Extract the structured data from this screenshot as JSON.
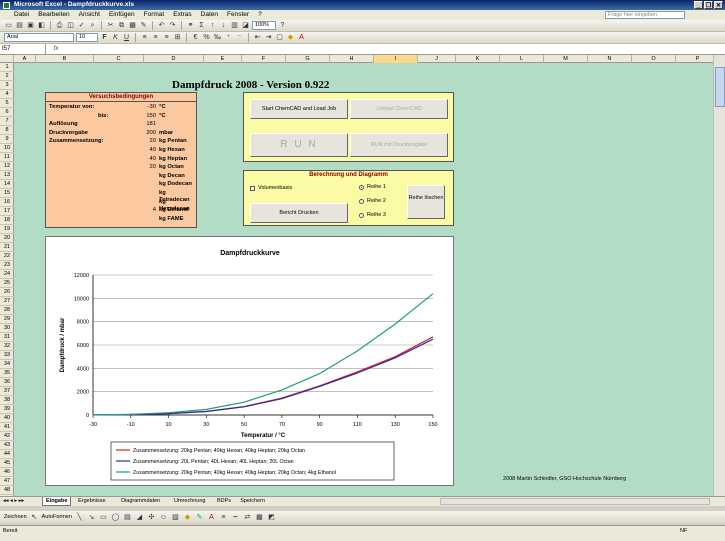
{
  "window": {
    "title": "Microsoft Excel - Dampfdruckkurve.xls"
  },
  "menu": {
    "items": [
      "Datei",
      "Bearbeiten",
      "Ansicht",
      "Einfügen",
      "Format",
      "Extras",
      "Daten",
      "Fenster",
      "?"
    ],
    "help_placeholder": "Frage hier eingeben"
  },
  "toolbar": {
    "zoom": "100%",
    "font": "Arial",
    "font_size": "10"
  },
  "formula_bar": {
    "cell_ref": "I57",
    "fx": "fx"
  },
  "columns": [
    "A",
    "B",
    "C",
    "D",
    "E",
    "F",
    "G",
    "H",
    "I",
    "J",
    "K",
    "L",
    "M",
    "N",
    "O",
    "P",
    "Q"
  ],
  "rows": [
    "1",
    "2",
    "3",
    "4",
    "5",
    "6",
    "7",
    "8",
    "9",
    "10",
    "11",
    "12",
    "13",
    "14",
    "15",
    "16",
    "17",
    "18",
    "19",
    "20",
    "21",
    "22",
    "23",
    "24",
    "25",
    "26",
    "27",
    "28",
    "29",
    "30",
    "31",
    "32",
    "33",
    "34",
    "35",
    "36",
    "37",
    "38",
    "39",
    "40",
    "41",
    "42",
    "43",
    "44",
    "45",
    "46",
    "47",
    "48"
  ],
  "sheet": {
    "title": "Dampfdruck 2008 - Version 0.922",
    "conditions": {
      "header": "Versuchsbedingungen",
      "rows": [
        {
          "label": "Temperatur von:",
          "value": "-30",
          "unit": "°C"
        },
        {
          "label": "bis:",
          "value": "150",
          "unit": "°C"
        },
        {
          "label": "Auflösung",
          "value": "181",
          "unit": ""
        },
        {
          "label": "Druckvorgabe",
          "value": "200",
          "unit": "mbar"
        },
        {
          "label": "Zusammensetzung:",
          "value": "20",
          "unit": "kg Pentan"
        },
        {
          "label": "",
          "value": "40",
          "unit": "kg Hexan"
        },
        {
          "label": "",
          "value": "40",
          "unit": "kg Heptan"
        },
        {
          "label": "",
          "value": "20",
          "unit": "kg Octan"
        },
        {
          "label": "",
          "value": "",
          "unit": "kg Decan"
        },
        {
          "label": "",
          "value": "",
          "unit": "kg Dodecan"
        },
        {
          "label": "",
          "value": "",
          "unit": "kg Tetradecan"
        },
        {
          "label": "",
          "value": "",
          "unit": "kg Hexadecan"
        },
        {
          "label": "",
          "value": "4",
          "unit": "kg Ethanol"
        },
        {
          "label": "",
          "value": "",
          "unit": "kg FAME"
        }
      ]
    },
    "buttons": {
      "start": "Start ChemCAD and Load Job",
      "unload": "Unload ChemCAD",
      "run": "R U N",
      "run_druck": "RUN mit Druckvorgabe",
      "bericht": "Bericht Drucken",
      "reihe_loeschen": "Reihe löschen"
    },
    "calc": {
      "header": "Berechnung und Diagramm",
      "volumenbasis": "Volumenbasis",
      "reihen": [
        "Reihe 1",
        "Reihe 2",
        "Reihe 3"
      ],
      "selected": "Reihe 1"
    },
    "credit": "2008 Martin Schindler, GSO Hochschule Nürnberg"
  },
  "chart_data": {
    "type": "line",
    "title": "Dampfdruckkurve",
    "xlabel": "Temperatur / °C",
    "ylabel": "Dampfdruck / mbar",
    "xlim": [
      -30,
      150
    ],
    "ylim": [
      0,
      12000
    ],
    "xticks": [
      -30,
      -10,
      10,
      30,
      50,
      70,
      90,
      110,
      130,
      150
    ],
    "yticks": [
      0,
      2000,
      4000,
      6000,
      8000,
      10000,
      12000
    ],
    "legend_position": "bottom",
    "x": [
      -30,
      -10,
      10,
      30,
      50,
      70,
      90,
      110,
      130,
      150
    ],
    "series": [
      {
        "name": "Zusammensetzung: 20kg Pentan; 40kg Hexan; 40kg Heptan; 20kg Octan",
        "color": "#d9202a",
        "values": [
          10,
          40,
          120,
          310,
          720,
          1450,
          2500,
          3700,
          5000,
          6700
        ]
      },
      {
        "name": "Zusammensetzung: 20L Pentan; 40L Hexan; 40L Heptan; 20L Octan",
        "color": "#2a2f9e",
        "values": [
          10,
          38,
          115,
          300,
          700,
          1400,
          2450,
          3600,
          4900,
          6500
        ]
      },
      {
        "name": "Zusammensetzung: 20kg Pentan; 40kg Hexan; 40kg Heptan; 20kg Octan; 4kg Ethanol",
        "color": "#1f9c86",
        "values": [
          15,
          60,
          200,
          480,
          1100,
          2150,
          3550,
          5500,
          7800,
          10400
        ]
      }
    ]
  },
  "sheet_tabs": [
    "Eingabe",
    "Ergebnisse",
    "Diagrammdaten",
    "Umrechnung",
    "BDPs",
    "Speichern"
  ],
  "active_tab": "Eingabe",
  "drawing_toolbar": {
    "draw": "Zeichnen",
    "autoshapes": "AutoFormen"
  },
  "status": {
    "left": "Bereit",
    "right": "NF"
  }
}
